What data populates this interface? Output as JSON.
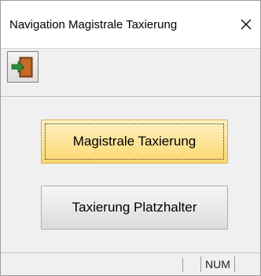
{
  "window": {
    "title": "Navigation Magistrale Taxierung"
  },
  "titlebar": {
    "close_icon": "close-icon"
  },
  "toolbar": {
    "exit_icon": "exit-door-icon"
  },
  "buttons": {
    "primary_label": "Magistrale Taxierung",
    "secondary_label": "Taxierung Platzhalter"
  },
  "statusbar": {
    "num_indicator": "NUM"
  },
  "colors": {
    "primary_button_top": "#fff0c4",
    "primary_button_bottom": "#fbd86f",
    "door_green": "#2e8b3a",
    "door_brown": "#a0521d"
  }
}
